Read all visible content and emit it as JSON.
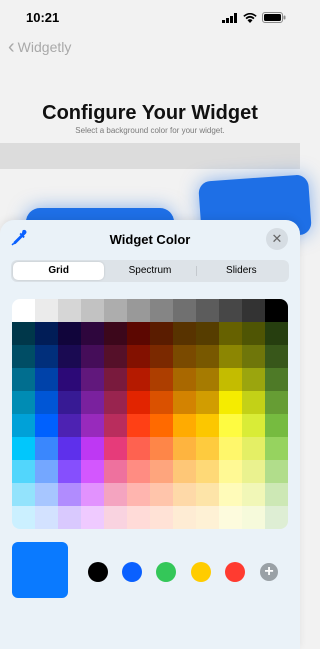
{
  "status_bar": {
    "time": "10:21"
  },
  "nav": {
    "back_label": "Widgetly"
  },
  "page": {
    "title": "Configure Your Widget",
    "subtitle": "Select a background color for your widget."
  },
  "sheet": {
    "title": "Widget Color",
    "tabs": [
      {
        "label": "Grid",
        "active": true
      },
      {
        "label": "Spectrum",
        "active": false
      },
      {
        "label": "Sliders",
        "active": false
      }
    ],
    "grid_rows": [
      [
        "#ffffff",
        "#ebebeb",
        "#d6d6d6",
        "#c2c2c2",
        "#adadad",
        "#999999",
        "#858585",
        "#707070",
        "#5c5c5c",
        "#474747",
        "#333333",
        "#000000"
      ],
      [
        "#00374a",
        "#011d57",
        "#11053b",
        "#2e063d",
        "#3c071b",
        "#5c0701",
        "#5a1c00",
        "#583300",
        "#563d00",
        "#666100",
        "#4f5504",
        "#263e0f"
      ],
      [
        "#004d65",
        "#012f7b",
        "#1a0a52",
        "#450d59",
        "#551029",
        "#831100",
        "#7b2900",
        "#7a4a00",
        "#785800",
        "#8c8602",
        "#6f760a",
        "#38571a"
      ],
      [
        "#016e8f",
        "#0042a9",
        "#2c0977",
        "#61187c",
        "#791a3d",
        "#b51a00",
        "#ad3e00",
        "#a96800",
        "#a67b01",
        "#c4bc00",
        "#9ba50e",
        "#4e7a27"
      ],
      [
        "#008cb4",
        "#0056d6",
        "#371a94",
        "#7a219e",
        "#99244f",
        "#e22400",
        "#da5100",
        "#d38301",
        "#d19d01",
        "#f5ec00",
        "#c3d117",
        "#669d34"
      ],
      [
        "#00a1d8",
        "#0061fe",
        "#4d22b2",
        "#982abc",
        "#b92d5d",
        "#ff4015",
        "#ff6a00",
        "#ffab01",
        "#fcc700",
        "#fefb41",
        "#d9ec37",
        "#76bb40"
      ],
      [
        "#01c7fc",
        "#3a87fd",
        "#5e30eb",
        "#be38f3",
        "#e63b7a",
        "#fe6250",
        "#fe8648",
        "#feb43f",
        "#fecb3e",
        "#fff76b",
        "#e4ef65",
        "#96d35f"
      ],
      [
        "#52d6fc",
        "#74a7ff",
        "#864ffd",
        "#d357fe",
        "#ee719e",
        "#ff8c82",
        "#fea57d",
        "#fec777",
        "#fed977",
        "#fff994",
        "#eaf28f",
        "#b1dd8b"
      ],
      [
        "#93e3fc",
        "#a7c6ff",
        "#b18cfe",
        "#e292fe",
        "#f4a4c0",
        "#ffb5af",
        "#ffc5ab",
        "#fed9a8",
        "#fde4a8",
        "#fffbb9",
        "#f1f7b7",
        "#cde8b5"
      ],
      [
        "#cbf0ff",
        "#d3e2ff",
        "#d9c9fe",
        "#efcaff",
        "#f9d3e0",
        "#ffdbd8",
        "#ffe2d6",
        "#feecd4",
        "#fef1d5",
        "#fdfbdd",
        "#f6fadb",
        "#deeed4"
      ]
    ],
    "selected_color": "#0a7aff",
    "presets": [
      "#000000",
      "#0a60ff",
      "#34c759",
      "#ffcc00",
      "#ff3b30"
    ]
  }
}
